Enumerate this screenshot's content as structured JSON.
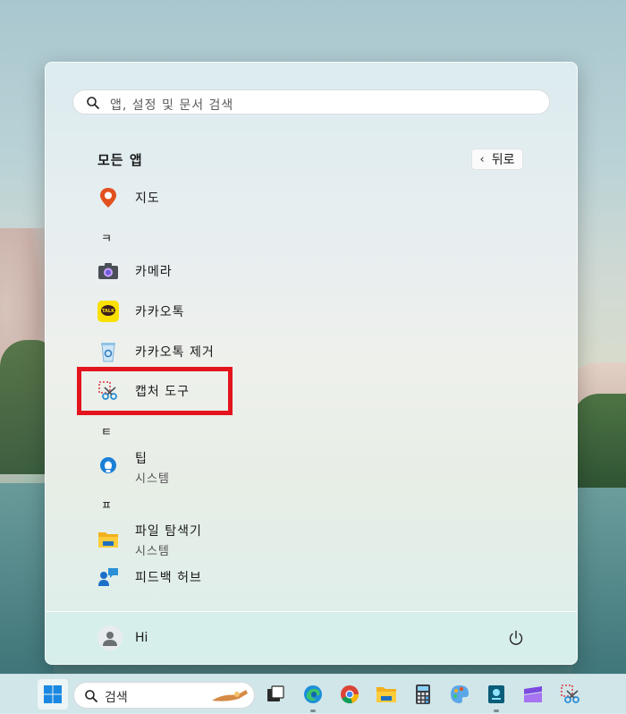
{
  "search": {
    "placeholder": "앱, 설정 및 문서 검색"
  },
  "all_apps": {
    "title": "모든 앱",
    "back_label": "뒤로"
  },
  "apps": [
    {
      "name": "지도",
      "icon": "maps-icon"
    },
    {
      "letter": "ㅋ"
    },
    {
      "name": "카메라",
      "icon": "camera-icon"
    },
    {
      "name": "카카오톡",
      "icon": "kakaotalk-icon"
    },
    {
      "name": "카카오톡 제거",
      "icon": "uninstall-icon"
    },
    {
      "name": "캡처 도구",
      "icon": "snipping-tool-icon"
    },
    {
      "letter": "ㅌ"
    },
    {
      "name": "팁",
      "sub": "시스템",
      "icon": "tips-icon"
    },
    {
      "letter": "ㅍ"
    },
    {
      "name": "파일 탐색기",
      "sub": "시스템",
      "icon": "file-explorer-icon"
    },
    {
      "name": "피드백 허브",
      "icon": "feedback-hub-icon"
    }
  ],
  "user": {
    "name": "Hi"
  },
  "taskbar": {
    "search_label": "검색",
    "apps": [
      "task-view-icon",
      "edge-icon",
      "chrome-icon",
      "file-explorer-icon",
      "calculator-icon",
      "paint-icon",
      "app-icon",
      "clipchamp-icon",
      "snipping-tool-icon"
    ]
  },
  "colors": {
    "highlight": "#e3141d",
    "accent": "#0078d4"
  }
}
